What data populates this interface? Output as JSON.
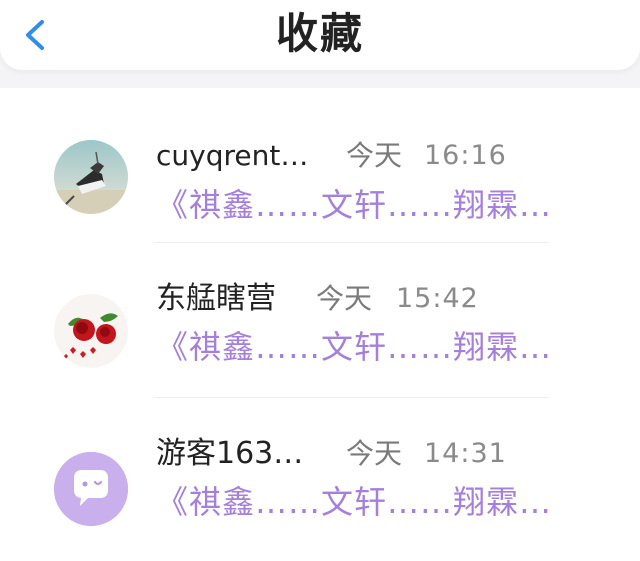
{
  "header": {
    "title": "收藏"
  },
  "items": [
    {
      "name": "cuyqrent…",
      "day": "今天",
      "time": "16:16",
      "preview": "《祺鑫……文轩……翔霖…",
      "avatar_icon": "sneaker-photo-avatar"
    },
    {
      "name": "东艋瞎营",
      "day": "今天",
      "time": "15:42",
      "preview": "《祺鑫……文轩……翔霖…",
      "avatar_icon": "roses-photo-avatar"
    },
    {
      "name": "游客163…",
      "day": "今天",
      "time": "14:31",
      "preview": "《祺鑫……文轩……翔霖…",
      "avatar_icon": "chat-bubble-avatar"
    }
  ],
  "colors": {
    "accent_purple": "#a47fdc",
    "back_blue": "#2f8fe6",
    "avatar_lavender": "#c9b0ec"
  }
}
